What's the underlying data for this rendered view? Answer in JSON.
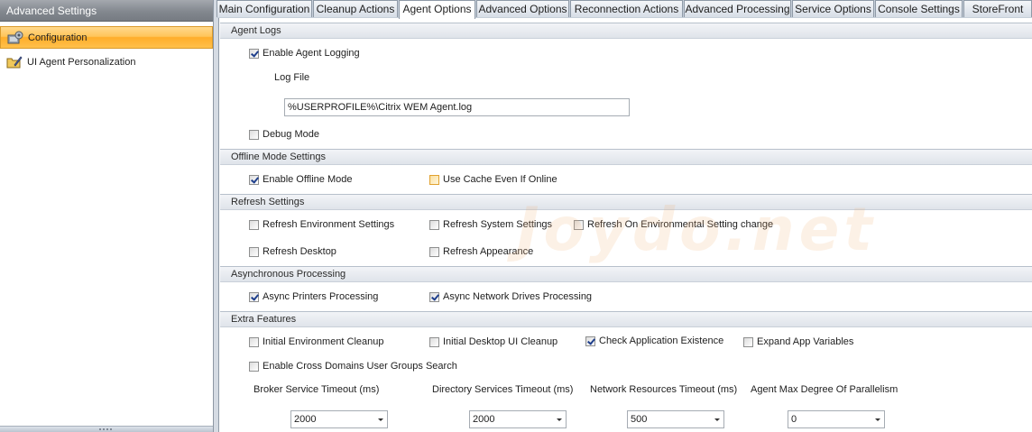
{
  "sidebar": {
    "title": "Advanced Settings",
    "items": [
      {
        "label": "Configuration",
        "icon": "configuration-icon",
        "selected": true
      },
      {
        "label": "UI Agent Personalization",
        "icon": "personalization-icon",
        "selected": false
      }
    ]
  },
  "tabs": [
    {
      "label": "Main Configuration",
      "active": false
    },
    {
      "label": "Cleanup Actions",
      "active": false
    },
    {
      "label": "Agent Options",
      "active": true
    },
    {
      "label": "Advanced Options",
      "active": false
    },
    {
      "label": "Reconnection Actions",
      "active": false
    },
    {
      "label": "Advanced Processing",
      "active": false
    },
    {
      "label": "Service Options",
      "active": false
    },
    {
      "label": "Console Settings",
      "active": false
    },
    {
      "label": "StoreFront",
      "active": false
    }
  ],
  "agent_logs": {
    "header": "Agent Logs",
    "enable_logging": {
      "label": "Enable Agent Logging",
      "checked": true
    },
    "log_file_label": "Log File",
    "log_file_value": "%USERPROFILE%\\Citrix WEM Agent.log",
    "debug_mode": {
      "label": "Debug Mode",
      "checked": false
    }
  },
  "offline_mode": {
    "header": "Offline Mode Settings",
    "enable_offline": {
      "label": "Enable Offline Mode",
      "checked": true
    },
    "use_cache": {
      "label": "Use Cache Even If Online",
      "checked": false
    }
  },
  "refresh": {
    "header": "Refresh Settings",
    "environment": {
      "label": "Refresh Environment Settings",
      "checked": false
    },
    "system": {
      "label": "Refresh System Settings",
      "checked": false
    },
    "on_change": {
      "label": "Refresh On Environmental Setting change",
      "checked": false
    },
    "desktop": {
      "label": "Refresh Desktop",
      "checked": false
    },
    "appearance": {
      "label": "Refresh Appearance",
      "checked": false
    }
  },
  "async": {
    "header": "Asynchronous Processing",
    "printers": {
      "label": "Async Printers Processing",
      "checked": true
    },
    "network_drives": {
      "label": "Async Network Drives Processing",
      "checked": true
    }
  },
  "extra": {
    "header": "Extra Features",
    "initial_env_cleanup": {
      "label": "Initial Environment Cleanup",
      "checked": false
    },
    "initial_desktop_cleanup": {
      "label": "Initial Desktop UI Cleanup",
      "checked": false
    },
    "check_app_existence": {
      "label": "Check Application Existence",
      "checked": true
    },
    "expand_app_variables": {
      "label": "Expand App Variables",
      "checked": false
    },
    "cross_domains": {
      "label": "Enable Cross Domains User Groups Search",
      "checked": false
    },
    "broker_timeout_label": "Broker Service Timeout  (ms)",
    "broker_timeout_value": "2000",
    "directory_timeout_label": "Directory Services Timeout  (ms)",
    "directory_timeout_value": "2000",
    "network_timeout_label": "Network Resources Timeout  (ms)",
    "network_timeout_value": "500",
    "parallelism_label": "Agent Max Degree Of Parallelism",
    "parallelism_value": "0"
  },
  "colors": {
    "selected_nav": "#ffc55a",
    "header_bar": "#83888f",
    "check_mark": "#1f3f8c"
  }
}
